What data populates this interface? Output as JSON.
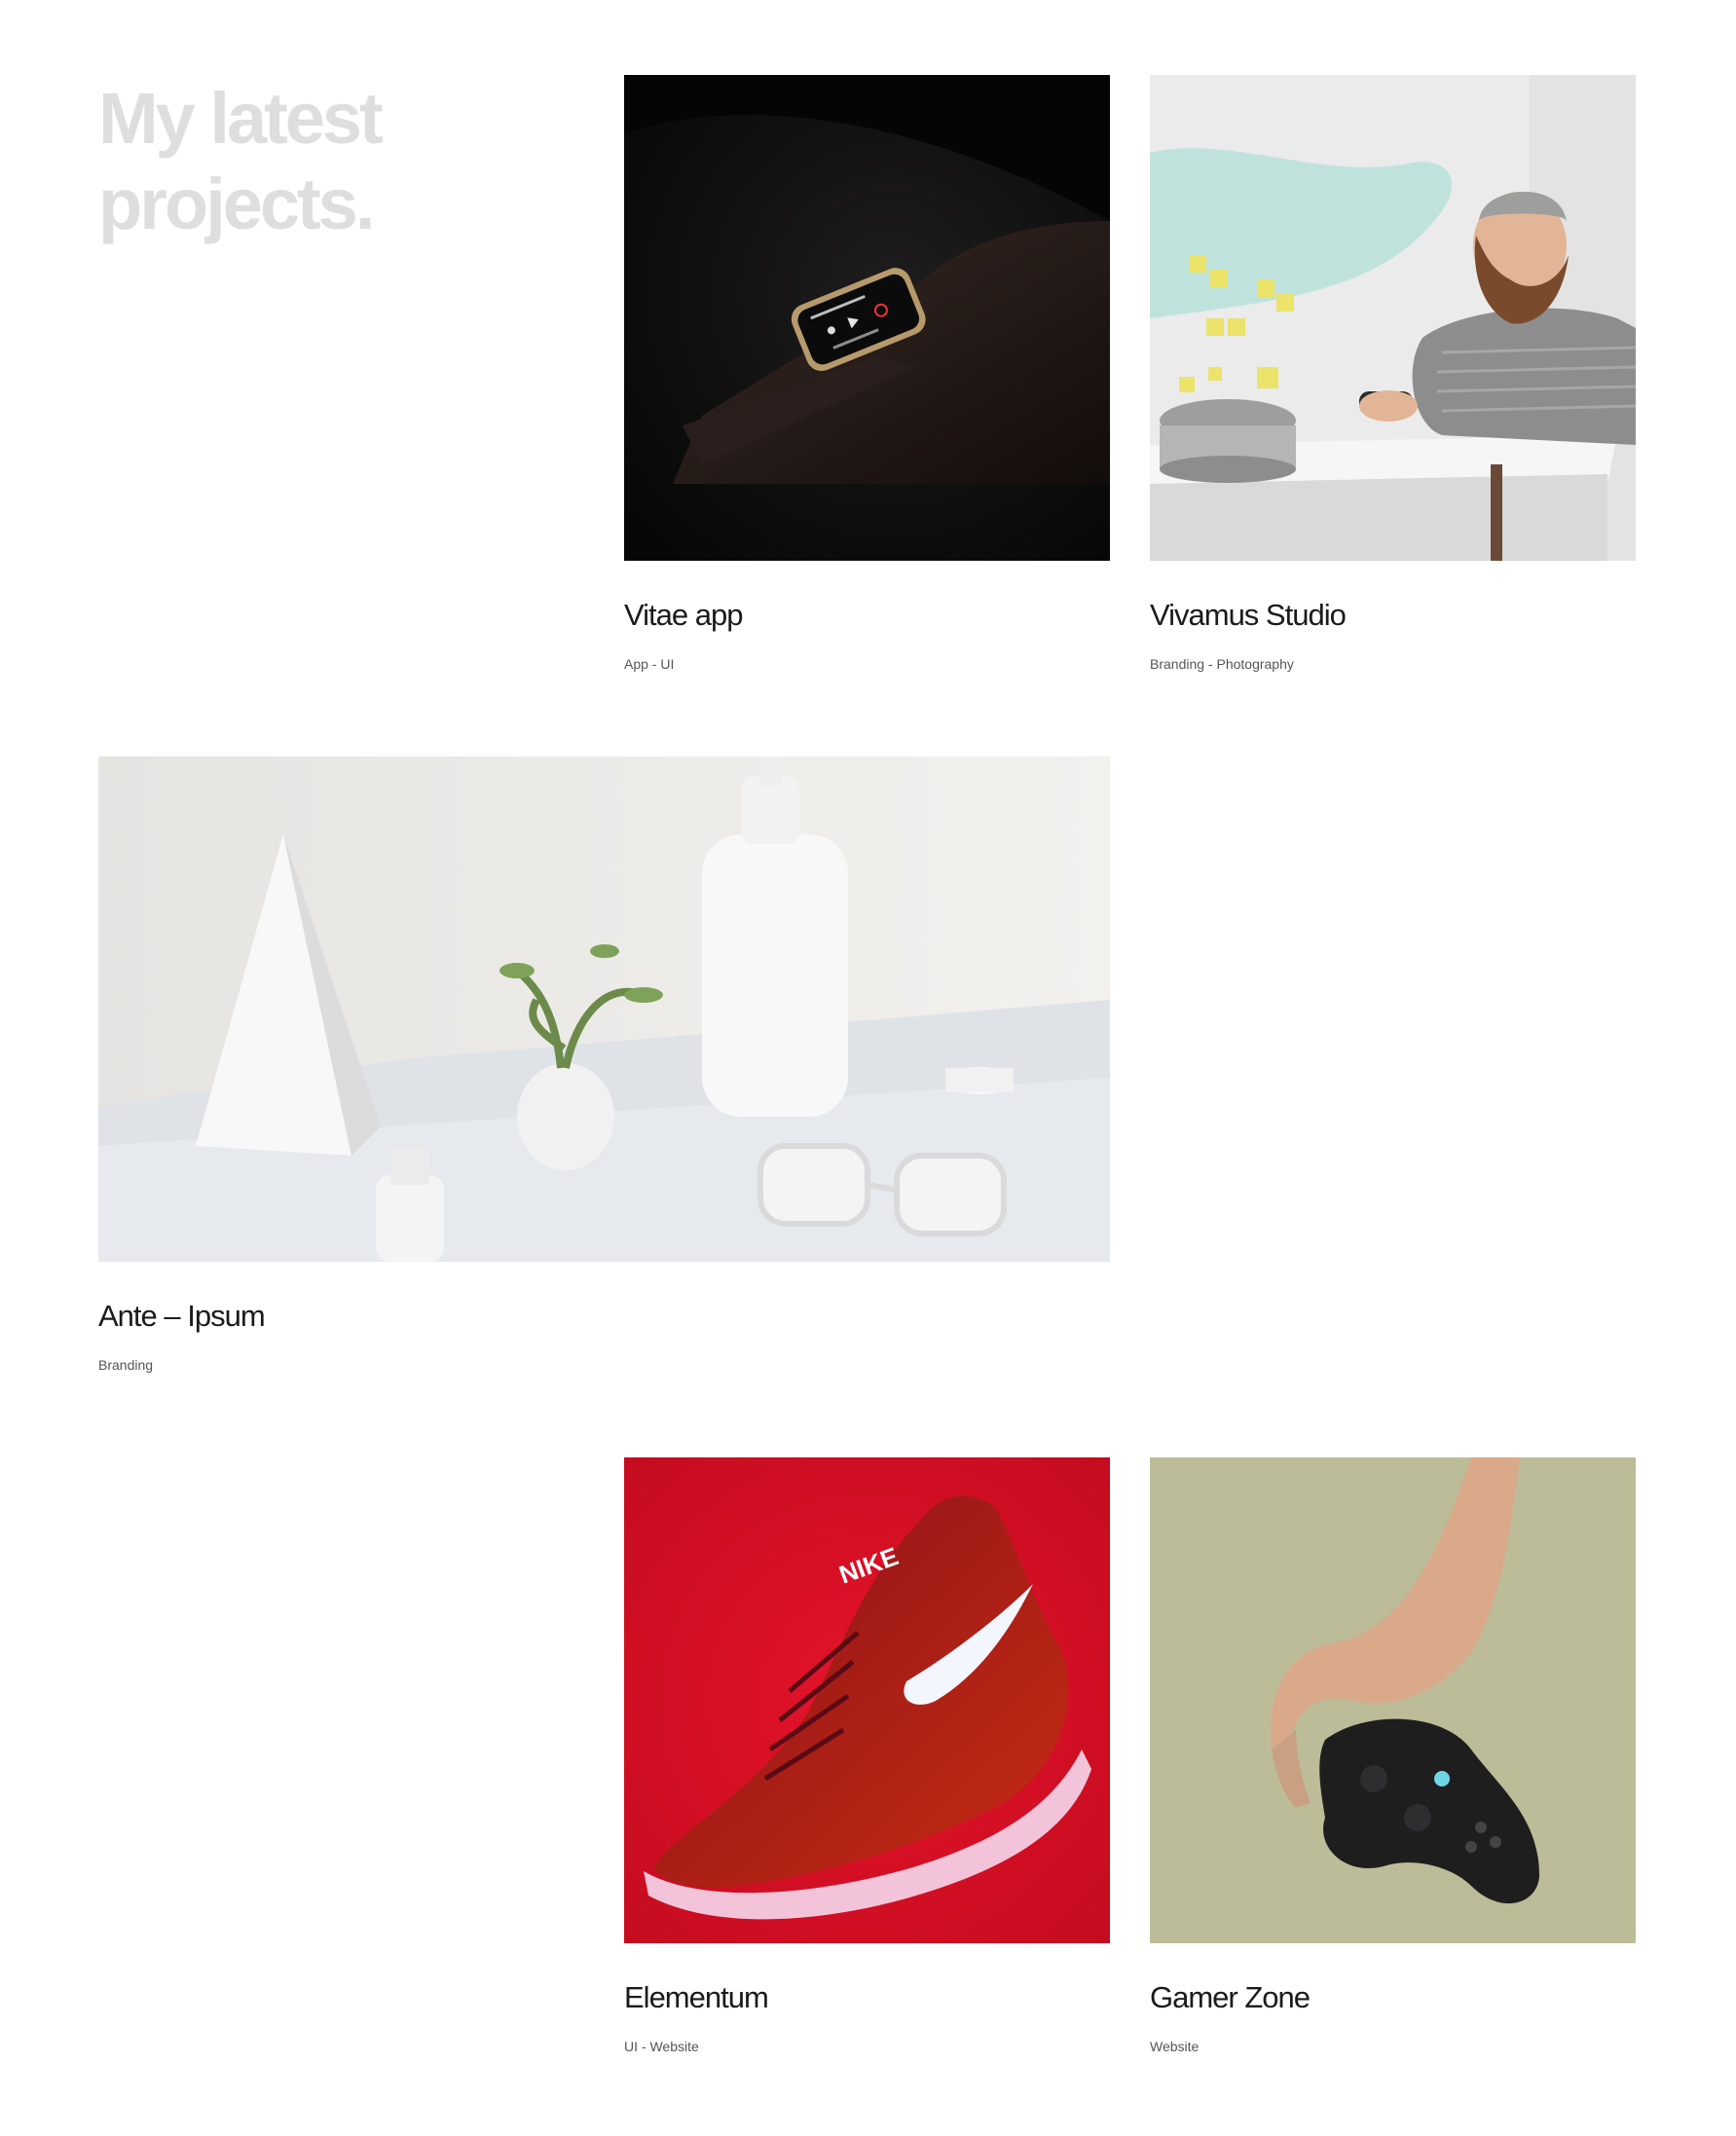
{
  "heading": {
    "line1": "My latest",
    "line2": "projects."
  },
  "projects": [
    {
      "title": "Vitae app",
      "tags": "App - UI",
      "image": "smartwatch on wrist in dark"
    },
    {
      "title": "Vivamus Studio",
      "tags": "Branding - Photography",
      "image": "smiling man with gamepad at white table"
    },
    {
      "title": "Ante – Ipsum",
      "tags": "Branding",
      "image": "white pyramid, bottle, plant and sunglasses"
    },
    {
      "title": "Elementum",
      "tags": "UI - Website",
      "image": "red sneaker on red background"
    },
    {
      "title": "Gamer Zone",
      "tags": "Website",
      "image": "hand holding game controller"
    }
  ],
  "colors": {
    "background": "#ffffff",
    "heading": "#dedede",
    "title": "#1b1b1b",
    "meta": "#555555"
  },
  "icons": {
    "watch": "smartwatch-icon",
    "controller": "gamepad-icon",
    "sneaker": "sneaker-icon"
  }
}
